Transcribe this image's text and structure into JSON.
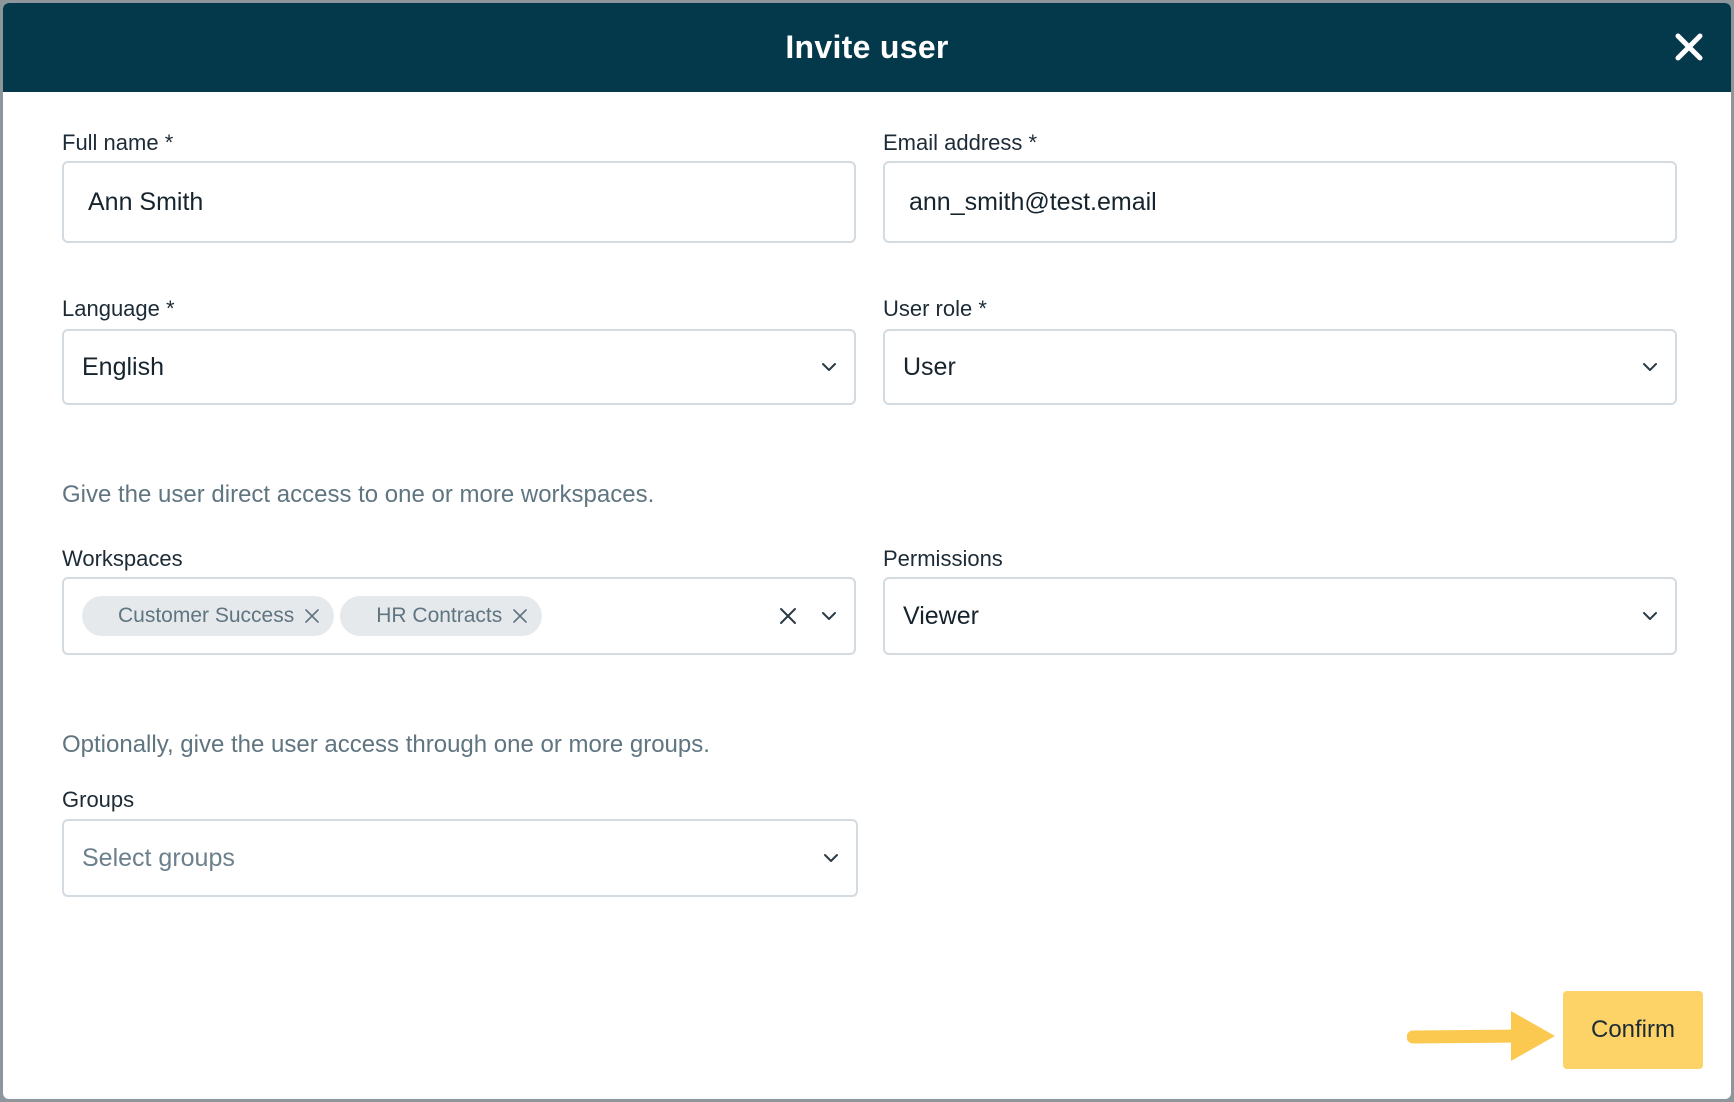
{
  "modal": {
    "title": "Invite user"
  },
  "form": {
    "full_name": {
      "label": "Full name *",
      "value": "Ann Smith"
    },
    "email": {
      "label": "Email address *",
      "value": "ann_smith@test.email"
    },
    "language": {
      "label": "Language *",
      "value": "English"
    },
    "user_role": {
      "label": "User role *",
      "value": "User"
    },
    "workspaces_hint": "Give the user direct access to one or more workspaces.",
    "workspaces": {
      "label": "Workspaces",
      "tags": [
        "Customer Success",
        "HR Contracts"
      ]
    },
    "permissions": {
      "label": "Permissions",
      "value": "Viewer"
    },
    "groups_hint": "Optionally, give the user access through one or more groups.",
    "groups": {
      "label": "Groups",
      "placeholder": "Select groups"
    }
  },
  "actions": {
    "confirm_label": "Confirm"
  },
  "colors": {
    "header_bg": "#03394b",
    "confirm_bg": "#fdd266",
    "arrow": "#fbc94f",
    "hint_text": "#5f7580",
    "tag_bg": "#e6e9ec"
  },
  "icons": {
    "close": "close-icon",
    "chevron": "chevron-down-icon",
    "remove_tag": "remove-tag-icon",
    "clear": "clear-icon",
    "arrow": "arrow-right-icon"
  }
}
